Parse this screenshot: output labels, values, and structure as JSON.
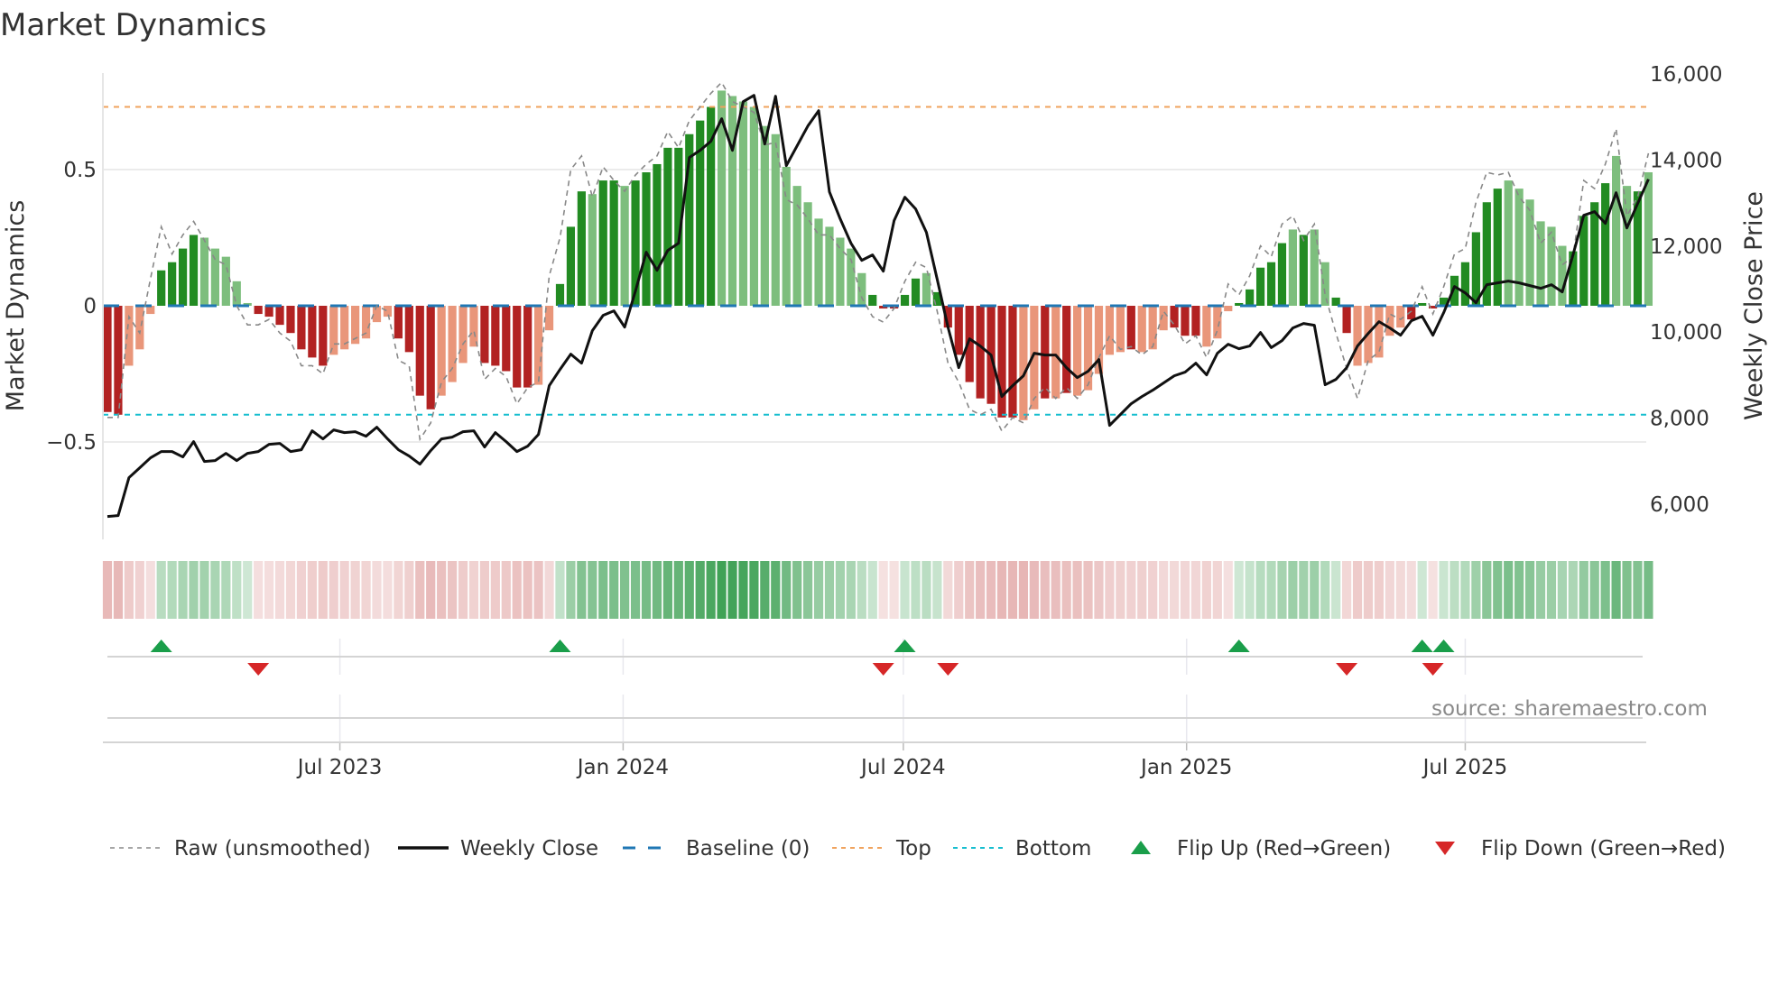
{
  "chart_data": {
    "type": "bar",
    "title": "Market Dynamics",
    "ylabel": "Market Dynamics",
    "y2label": "Weekly Close Price",
    "ylim": [
      -0.858,
      0.854
    ],
    "y2lim": [
      5200,
      16200
    ],
    "y_ticks": [
      {
        "v": 0.5,
        "label": "0.5"
      },
      {
        "v": 0,
        "label": "0"
      },
      {
        "v": -0.5,
        "label": "−0.5"
      }
    ],
    "y2_ticks": [
      {
        "v": 16000,
        "label": "16,000"
      },
      {
        "v": 14000,
        "label": "14,000"
      },
      {
        "v": 12000,
        "label": "12,000"
      },
      {
        "v": 10000,
        "label": "10,000"
      },
      {
        "v": 8000,
        "label": "8,000"
      },
      {
        "v": 6000,
        "label": "6,000"
      }
    ],
    "x_start": "2023-01-31",
    "x_step_days": 7,
    "x_ticks": [
      {
        "date": "2023-07-01",
        "label": "Jul 2023"
      },
      {
        "date": "2024-01-01",
        "label": "Jan 2024"
      },
      {
        "date": "2024-07-01",
        "label": "Jul 2024"
      },
      {
        "date": "2025-01-01",
        "label": "Jan 2025"
      },
      {
        "date": "2025-07-01",
        "label": "Jul 2025"
      }
    ],
    "grid": true,
    "top_level": 0.73,
    "bottom_level": -0.4,
    "baseline": 0,
    "smoothed": [
      -0.39,
      -0.4,
      -0.22,
      -0.16,
      -0.03,
      0.13,
      0.16,
      0.21,
      0.26,
      0.25,
      0.21,
      0.18,
      0.09,
      0.01,
      -0.03,
      -0.04,
      -0.07,
      -0.1,
      -0.16,
      -0.19,
      -0.22,
      -0.18,
      -0.16,
      -0.14,
      -0.12,
      -0.06,
      -0.04,
      -0.12,
      -0.17,
      -0.33,
      -0.38,
      -0.33,
      -0.28,
      -0.21,
      -0.15,
      -0.21,
      -0.22,
      -0.24,
      -0.3,
      -0.3,
      -0.29,
      -0.09,
      0.08,
      0.29,
      0.42,
      0.41,
      0.46,
      0.46,
      0.44,
      0.46,
      0.49,
      0.52,
      0.58,
      0.58,
      0.63,
      0.68,
      0.73,
      0.79,
      0.77,
      0.75,
      0.73,
      0.66,
      0.63,
      0.51,
      0.44,
      0.38,
      0.32,
      0.29,
      0.25,
      0.21,
      0.12,
      0.04,
      -0.01,
      -0.01,
      0.04,
      0.1,
      0.12,
      0.05,
      -0.08,
      -0.18,
      -0.28,
      -0.34,
      -0.36,
      -0.41,
      -0.41,
      -0.42,
      -0.38,
      -0.34,
      -0.34,
      -0.32,
      -0.33,
      -0.31,
      -0.25,
      -0.18,
      -0.17,
      -0.16,
      -0.17,
      -0.16,
      -0.09,
      -0.08,
      -0.11,
      -0.11,
      -0.15,
      -0.12,
      -0.02,
      0.01,
      0.06,
      0.14,
      0.16,
      0.23,
      0.28,
      0.26,
      0.28,
      0.16,
      0.03,
      -0.1,
      -0.22,
      -0.21,
      -0.19,
      -0.11,
      -0.08,
      -0.05,
      0.01,
      -0.01,
      0.03,
      0.11,
      0.16,
      0.27,
      0.38,
      0.43,
      0.46,
      0.43,
      0.39,
      0.31,
      0.29,
      0.22,
      0.2,
      0.33,
      0.38,
      0.45,
      0.55,
      0.44,
      0.42,
      0.49
    ],
    "shade": "DDLLLDDDDLLLLLDDDDDDDLLLLLLDDDDLLLLDDDDDLLDDDLDDLDDDDDDDDLLLLLLLLLLLLLLDDDDDLDDDDDDDDLLDLDLLLLLDLLLDDDLLLDDDDDLDLLDDLLLLLDDDDDDDDDLLLLLLDDDDLLD",
    "raw": [
      -0.41,
      -0.41,
      -0.04,
      -0.1,
      0.1,
      0.29,
      0.19,
      0.26,
      0.31,
      0.24,
      0.17,
      0.15,
      0.0,
      -0.07,
      -0.07,
      -0.05,
      -0.1,
      -0.13,
      -0.22,
      -0.22,
      -0.25,
      -0.14,
      -0.14,
      -0.12,
      -0.1,
      0.0,
      -0.02,
      -0.2,
      -0.22,
      -0.49,
      -0.43,
      -0.28,
      -0.23,
      -0.14,
      -0.09,
      -0.27,
      -0.23,
      -0.26,
      -0.36,
      -0.3,
      -0.28,
      0.11,
      0.25,
      0.5,
      0.55,
      0.4,
      0.51,
      0.46,
      0.42,
      0.48,
      0.52,
      0.55,
      0.64,
      0.58,
      0.68,
      0.73,
      0.78,
      0.82,
      0.75,
      0.73,
      0.71,
      0.59,
      0.6,
      0.39,
      0.37,
      0.32,
      0.26,
      0.26,
      0.21,
      0.17,
      0.03,
      -0.04,
      -0.06,
      -0.01,
      0.09,
      0.16,
      0.14,
      -0.02,
      -0.21,
      -0.28,
      -0.38,
      -0.4,
      -0.38,
      -0.46,
      -0.41,
      -0.43,
      -0.34,
      -0.3,
      -0.34,
      -0.3,
      -0.34,
      -0.29,
      -0.19,
      -0.11,
      -0.16,
      -0.15,
      -0.18,
      -0.15,
      -0.02,
      -0.07,
      -0.14,
      -0.11,
      -0.19,
      -0.09,
      0.08,
      0.04,
      0.11,
      0.22,
      0.18,
      0.3,
      0.33,
      0.24,
      0.3,
      0.04,
      -0.1,
      -0.23,
      -0.34,
      -0.2,
      -0.17,
      -0.03,
      -0.05,
      -0.02,
      0.07,
      -0.03,
      0.07,
      0.19,
      0.21,
      0.38,
      0.49,
      0.48,
      0.49,
      0.4,
      0.35,
      0.23,
      0.27,
      0.15,
      0.18,
      0.46,
      0.43,
      0.52,
      0.65,
      0.33,
      0.4,
      0.56
    ],
    "close": [
      5715,
      5736,
      6617,
      6847,
      7078,
      7224,
      7224,
      7099,
      7455,
      6994,
      7015,
      7182,
      7015,
      7182,
      7224,
      7392,
      7413,
      7224,
      7266,
      7706,
      7518,
      7727,
      7664,
      7685,
      7581,
      7790,
      7518,
      7266,
      7120,
      6931,
      7245,
      7518,
      7560,
      7685,
      7706,
      7329,
      7664,
      7455,
      7224,
      7350,
      7623,
      8755,
      9132,
      9488,
      9279,
      10033,
      10390,
      10494,
      10117,
      10955,
      11857,
      11437,
      11899,
      12066,
      14057,
      14225,
      14435,
      14959,
      14225,
      15357,
      15504,
      14372,
      15483,
      13869,
      14330,
      14791,
      15147,
      13261,
      12632,
      12066,
      11668,
      11794,
      11416,
      12590,
      13135,
      12863,
      12318,
      11228,
      10117,
      9174,
      9844,
      9677,
      9467,
      8503,
      8755,
      8985,
      9509,
      9467,
      9467,
      9174,
      8943,
      9090,
      9362,
      7832,
      8084,
      8335,
      8503,
      8650,
      8817,
      8985,
      9069,
      9279,
      9006,
      9509,
      9719,
      9614,
      9677,
      9991,
      9640,
      9802,
      10096,
      10201,
      10159,
      8776,
      8901,
      9174,
      9677,
      9970,
      10243,
      10096,
      9928,
      10264,
      10369,
      9928,
      10452,
      11060,
      10913,
      10683,
      11102,
      11144,
      11186,
      11144,
      11081,
      11018,
      11102,
      10934,
      11794,
      12716,
      12800,
      12527,
      13240,
      12422,
      12988,
      13554
    ],
    "flip_up_weeks": [
      6,
      43,
      75,
      106,
      123,
      125
    ],
    "flip_down_weeks": [
      15,
      73,
      79,
      116,
      124
    ],
    "legend": [
      {
        "key": "raw",
        "label": "Raw (unsmoothed)"
      },
      {
        "key": "close",
        "label": "Weekly Close"
      },
      {
        "key": "baseline",
        "label": "Baseline (0)"
      },
      {
        "key": "top",
        "label": "Top"
      },
      {
        "key": "bottom",
        "label": "Bottom"
      },
      {
        "key": "up",
        "label": "Flip Up (Red→Green)"
      },
      {
        "key": "down",
        "label": "Flip Down (Green→Red)"
      }
    ],
    "legend_placement": "bottom",
    "annotation": "source: sharemaestro.com"
  },
  "colors": {
    "dark_green": "#228b22",
    "light_green": "#7dbe7d",
    "dark_red": "#b22222",
    "light_red": "#e9967a",
    "raw": "#888888",
    "close": "#111111",
    "baseline": "#1f77b4",
    "top": "#f0a35e",
    "bottom": "#17becf",
    "up": "#1a9e4a",
    "down": "#d62728"
  }
}
